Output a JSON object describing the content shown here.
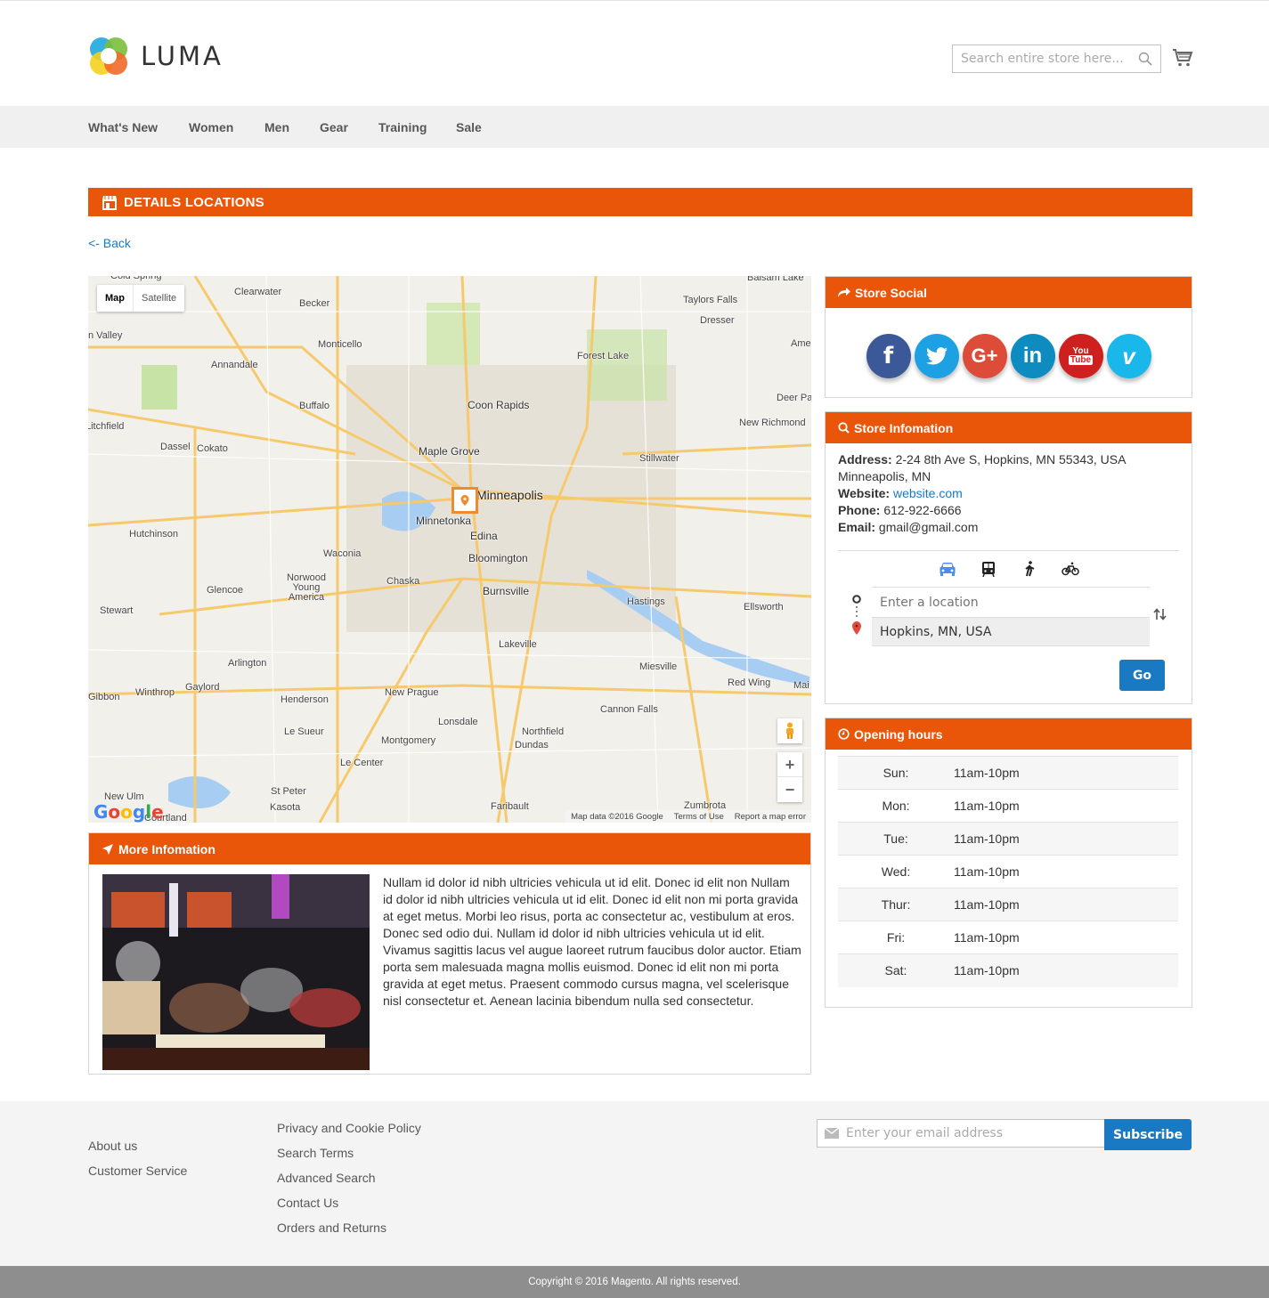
{
  "header": {
    "brand": "LUMA",
    "search_placeholder": "Search entire store here...",
    "search_icon": "search-icon",
    "cart_icon": "cart-icon"
  },
  "nav": {
    "items": [
      {
        "label": "What's New"
      },
      {
        "label": "Women"
      },
      {
        "label": "Men"
      },
      {
        "label": "Gear"
      },
      {
        "label": "Training"
      },
      {
        "label": "Sale"
      }
    ]
  },
  "page": {
    "title": "DETAILS LOCATIONS",
    "title_icon": "store-icon",
    "back_label": "<- Back",
    "accent_color": "#e95609",
    "link_color": "#1979c3"
  },
  "map": {
    "type_options": [
      {
        "label": "Map",
        "selected": true
      },
      {
        "label": "Satellite",
        "selected": false
      }
    ],
    "place_labels": [
      "Cold Spring",
      "Clearwater",
      "Becker",
      "Monticello",
      "Annandale",
      "Taylors Falls",
      "Dresser",
      "Balsam Lake",
      "Forest Lake",
      "Coon Rapids",
      "Buffalo",
      "Maple Grove",
      "Stillwater",
      "New Richmond",
      "Deer Pa",
      "Ame",
      "Litchfield",
      "Dassel",
      "Cokato",
      "Minneapolis",
      "Minnetonka",
      "Edina",
      "Bloomington",
      "Hutchinson",
      "Waconia",
      "Chaska",
      "Norwood Young America",
      "Glencoe",
      "Stewart",
      "Burnsville",
      "Hastings",
      "Ellsworth",
      "Lakeville",
      "Arlington",
      "Gaylord",
      "Winthrop",
      "Gibbon",
      "Henderson",
      "New Prague",
      "Miesville",
      "Red Wing",
      "Mai",
      "Cannon Falls",
      "Lonsdale",
      "Le Sueur",
      "Montgomery",
      "Northfield",
      "Dundas",
      "Le Center",
      "New Ulm",
      "St Peter",
      "Kasota",
      "Courtland",
      "Faribault",
      "Zumbrota",
      "n Valley"
    ],
    "zoom_in_label": "+",
    "zoom_out_label": "−",
    "google_logo": "Google",
    "attribution": [
      "Map data ©2016 Google",
      "Terms of Use",
      "Report a map error"
    ]
  },
  "more_info": {
    "title": "More Infomation",
    "icon": "rocket-icon",
    "text": "Nullam id dolor id nibh ultricies vehicula ut id elit. Donec id elit non Nullam id dolor id nibh ultricies vehicula ut id elit. Donec id elit non mi porta gravida at eget metus. Morbi leo risus, porta ac consectetur ac, vestibulum at eros. Donec sed odio dui. Nullam id dolor id nibh ultricies vehicula ut id elit. Vivamus sagittis lacus vel augue laoreet rutrum faucibus dolor auctor. Etiam porta sem malesuada magna mollis euismod. Donec id elit non mi porta gravida at eget metus. Praesent commodo cursus magna, vel scelerisque nisl consectetur et. Aenean lacinia bibendum nulla sed consectetur."
  },
  "social": {
    "title": "Store Social",
    "icon": "share-icon",
    "networks": [
      {
        "name": "facebook",
        "glyph": "f",
        "color": "#3b5998"
      },
      {
        "name": "twitter",
        "glyph": "t",
        "color": "#1da1e2"
      },
      {
        "name": "google-plus",
        "glyph": "G+",
        "color": "#dd4b39"
      },
      {
        "name": "linkedin",
        "glyph": "in",
        "color": "#0e8bbf"
      },
      {
        "name": "youtube",
        "glyph": "You Tube",
        "color": "#cd201f"
      },
      {
        "name": "vimeo",
        "glyph": "v",
        "color": "#1ab7ea"
      }
    ]
  },
  "store_info": {
    "title": "Store Infomation",
    "icon": "search-icon",
    "address_label": "Address:",
    "address": "2-24 8th Ave S, Hopkins, MN 55343, USA",
    "city": "Minneapolis, MN",
    "website_label": "Website:",
    "website": "website.com",
    "phone_label": "Phone:",
    "phone": "612-922-6666",
    "email_label": "Email:",
    "email": "gmail@gmail.com",
    "travel_modes": [
      {
        "name": "car",
        "active": true
      },
      {
        "name": "transit",
        "active": false
      },
      {
        "name": "walk",
        "active": false
      },
      {
        "name": "bike",
        "active": false
      }
    ],
    "origin_placeholder": "Enter a location",
    "destination_value": "Hopkins, MN, USA",
    "go_label": "Go"
  },
  "hours": {
    "title": "Opening hours",
    "icon": "clock-icon",
    "rows": [
      {
        "day": "Sun:",
        "time": "11am-10pm"
      },
      {
        "day": "Mon:",
        "time": "11am-10pm"
      },
      {
        "day": "Tue:",
        "time": "11am-10pm"
      },
      {
        "day": "Wed:",
        "time": "11am-10pm"
      },
      {
        "day": "Thur:",
        "time": "11am-10pm"
      },
      {
        "day": "Fri:",
        "time": "11am-10pm"
      },
      {
        "day": "Sat:",
        "time": "11am-10pm"
      }
    ]
  },
  "footer": {
    "col1": [
      "About us",
      "Customer Service"
    ],
    "col2": [
      "Privacy and Cookie Policy",
      "Search Terms",
      "Advanced Search",
      "Contact Us",
      "Orders and Returns"
    ],
    "newsletter_placeholder": "Enter your email address",
    "subscribe_label": "Subscribe",
    "copyright": "Copyright © 2016 Magento. All rights reserved."
  }
}
